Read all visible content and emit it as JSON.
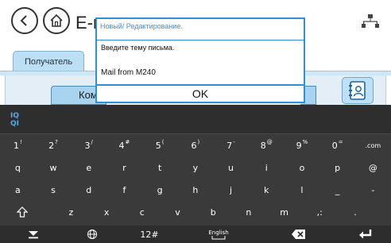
{
  "title_fragment": "E-r",
  "tab_label": "Получатель",
  "to_button_label": "Ком",
  "dialog": {
    "title": "Новый/ Редактирование.",
    "prompt": "Введите тему письма.",
    "input_value": "Mail from M240",
    "ok_label": "OK"
  },
  "keyboard": {
    "row1": [
      {
        "main": "1",
        "sup": "!"
      },
      {
        "main": "2",
        "sup": "?"
      },
      {
        "main": "3",
        "sup": "/"
      },
      {
        "main": "4",
        "sup": "#"
      },
      {
        "main": "5",
        "sup": "("
      },
      {
        "main": "6",
        "sup": ")"
      },
      {
        "main": "7",
        "sup": "-"
      },
      {
        "main": "8",
        "sup": "@"
      },
      {
        "main": "9",
        "sup": "%"
      },
      {
        "main": "0",
        "sup": "="
      },
      {
        "main": ".com",
        "sup": ""
      }
    ],
    "row2": [
      "q",
      "w",
      "e",
      "r",
      "t",
      "y",
      "u",
      "i",
      "o",
      "p",
      "@"
    ],
    "row3": [
      "a",
      "s",
      "d",
      "f",
      "g",
      "h",
      "j",
      "k",
      "l",
      "_",
      "-"
    ],
    "row4": [
      "z",
      "x",
      "c",
      "v",
      "b",
      "n",
      "m",
      ",:",
      "."
    ],
    "symbols_label": "12#",
    "language_label": "English"
  },
  "colors": {
    "accent": "#2f8fd8",
    "keyboard_bg": "#3a3a3a",
    "tab_bg": "#bcdff3"
  }
}
